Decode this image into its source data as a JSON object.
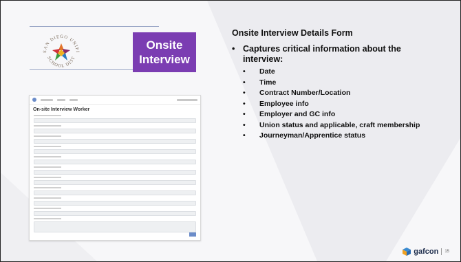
{
  "badge": {
    "line1": "Onsite",
    "line2": "Interview"
  },
  "logo": {
    "text": "SAN DIEGO UNIFIED SCHOOL DISTRICT"
  },
  "form_screenshot": {
    "title": "On-site Interview Worker"
  },
  "content": {
    "heading": "Onsite Interview Details Form",
    "main_bullet": "Captures critical information about the interview:",
    "sub_bullets": [
      "Date",
      "Time",
      "Contract Number/Location",
      "Employee info",
      "Employer and GC info",
      "Union status and applicable, craft membership",
      "Journeyman/Apprentice status"
    ]
  },
  "footer": {
    "brand": "gafcon",
    "page": "15"
  },
  "colors": {
    "badge": "#7b3db2",
    "accent": "#6b8cc9"
  }
}
